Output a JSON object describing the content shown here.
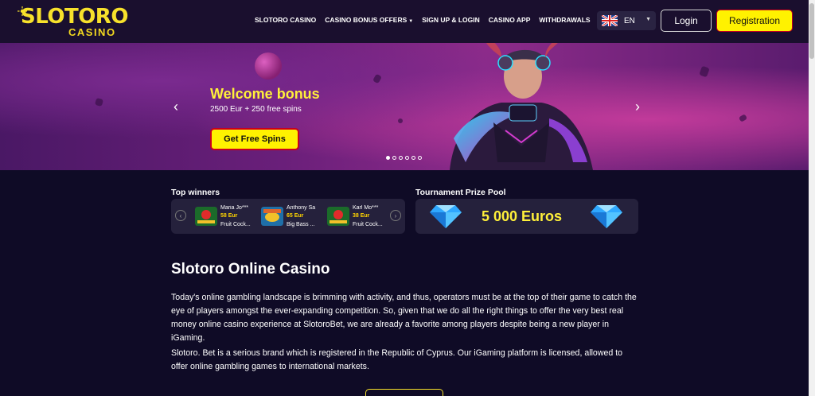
{
  "header": {
    "logo": {
      "brand": "SLOTORO",
      "sub": "CASINO"
    },
    "nav": [
      {
        "label": "SLOTORO CASINO"
      },
      {
        "label": "CASINO BONUS OFFERS",
        "has_dropdown": true
      },
      {
        "label": "SIGN UP & LOGIN"
      },
      {
        "label": "CASINO APP"
      },
      {
        "label": "WITHDRAWALS"
      }
    ],
    "language": "EN",
    "login_label": "Login",
    "register_label": "Registration"
  },
  "banner": {
    "title": "Welcome bonus",
    "subtitle": "2500 Eur + 250 free spins",
    "cta_label": "Get Free Spins",
    "prev_arrow": "‹",
    "next_arrow": "›",
    "slide_count": 6,
    "active_slide": 1
  },
  "winners": {
    "label": "Top winners",
    "items": [
      {
        "name": "Maria Jo***",
        "amount": "58 Eur",
        "game": "Fruit Cock..."
      },
      {
        "name": "Anthony Sa",
        "amount": "65 Eur",
        "game": "Big Bass ..."
      },
      {
        "name": "Karl Mo***",
        "amount": "38 Eur",
        "game": "Fruit Cock..."
      }
    ]
  },
  "prize_pool": {
    "label": "Tournament Prize Pool",
    "value": "5 000 Euros"
  },
  "content": {
    "heading": "Slotoro Online Casino",
    "paragraphs": [
      "Today's online gambling landscape is brimming with activity, and thus, operators must be at the top of their game to catch the eye of players amongst the ever-expanding competition. So, given that we do all the right things to offer the very best real money online casino experience at SlotoroBet, we are already a favorite among players despite being a new player in iGaming.",
      "Slotoro. Bet is a serious brand which is registered in the Republic of Cyprus. Our iGaming platform is licensed, allowed to offer online gambling games to international markets."
    ]
  },
  "colors": {
    "accent_yellow": "#fff200",
    "header_bg": "#1a0f2e",
    "page_bg": "#0f0b26",
    "card_bg": "#25213c"
  }
}
